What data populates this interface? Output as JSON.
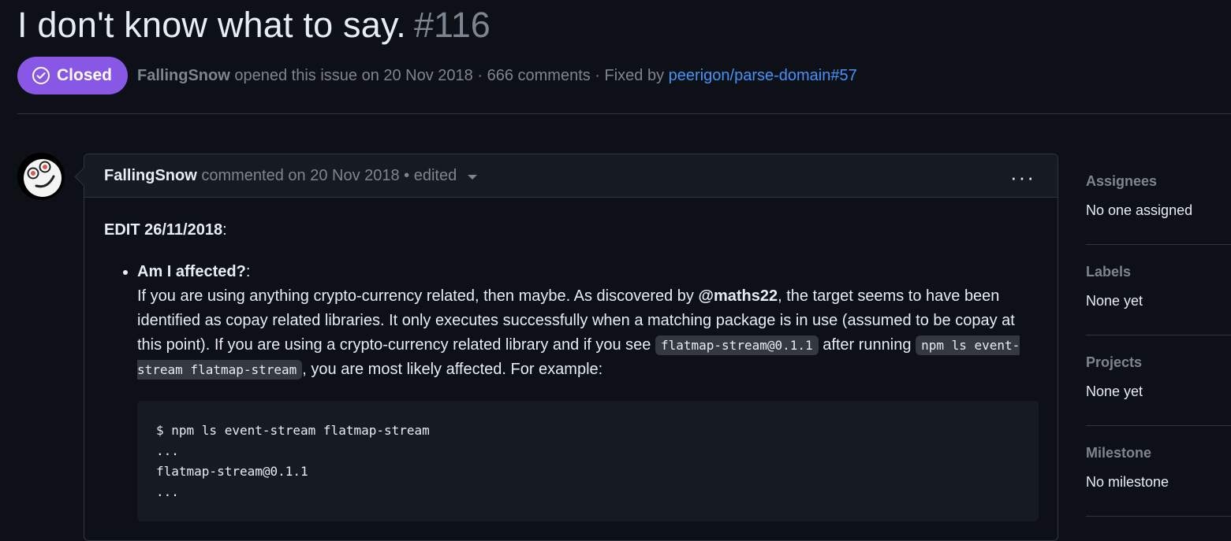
{
  "issue": {
    "title": "I don't know what to say.",
    "number": "#116",
    "state": "Closed",
    "state_color": "#8957e5",
    "author": "FallingSnow",
    "opened_text": "opened this issue on 20 Nov 2018 · 666 comments · Fixed by",
    "fixed_by": "peerigon/parse-domain#57"
  },
  "comment": {
    "author": "FallingSnow",
    "meta": "commented on 20 Nov 2018 • edited",
    "menu_icon": "kebab-horizontal-icon",
    "avatar_icon": "avatar-face-icon",
    "edit_label": "EDIT 26/11/2018",
    "edit_colon": ":",
    "item_title": "Am I affected?",
    "item_colon": ":",
    "p1": "If you are using anything crypto-currency related, then maybe. As discovered by ",
    "mention": "@maths22",
    "p2": ", the target seems to have been identified as copay related libraries. It only executes successfully when a matching package is in use (assumed to be copay at this point). If you are using a crypto-currency related library and if you see ",
    "code1": "flatmap-stream@0.1.1",
    "p3": " after running ",
    "code2": "npm ls event-stream flatmap-stream",
    "p4": ", you are most likely affected. For example:",
    "code_block": "$ npm ls event-stream flatmap-stream\n...\nflatmap-stream@0.1.1\n..."
  },
  "sidebar": {
    "sections": [
      {
        "title": "Assignees",
        "value": "No one assigned"
      },
      {
        "title": "Labels",
        "value": "None yet"
      },
      {
        "title": "Projects",
        "value": "None yet"
      },
      {
        "title": "Milestone",
        "value": "No milestone"
      }
    ]
  },
  "colors": {
    "background": "#0d1117",
    "link": "#4493f8",
    "muted": "#7d8590"
  }
}
